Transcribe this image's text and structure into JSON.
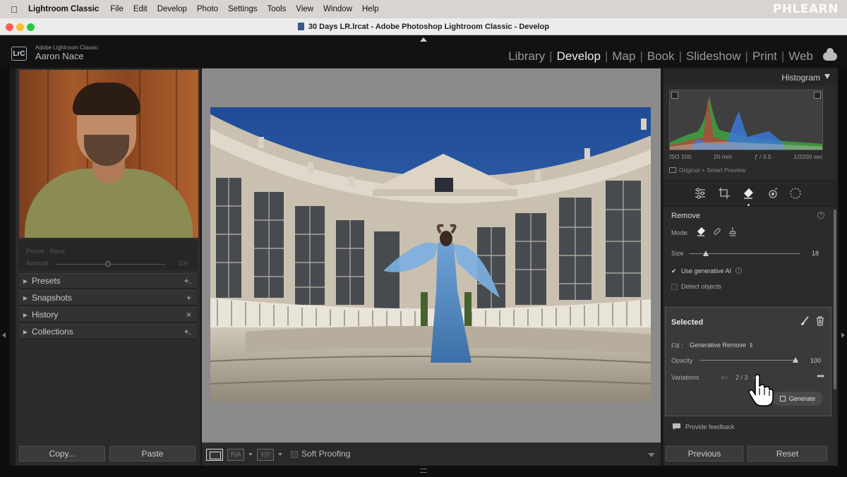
{
  "menubar": {
    "app_name": "Lightroom Classic",
    "items": [
      "File",
      "Edit",
      "Develop",
      "Photo",
      "Settings",
      "Tools",
      "View",
      "Window",
      "Help"
    ],
    "watermark": "PHLEARN"
  },
  "window": {
    "title": "30 Days LR.lrcat - Adobe Photoshop Lightroom Classic - Develop"
  },
  "identity": {
    "badge": "LrC",
    "app_line": "Adobe Lightroom Classic",
    "user_name": "Aaron Nace"
  },
  "modules": {
    "items": [
      "Library",
      "Develop",
      "Map",
      "Book",
      "Slideshow",
      "Print",
      "Web"
    ],
    "active": "Develop"
  },
  "left_panel": {
    "preset": {
      "label": "Preset : None",
      "amount_label": "Amount",
      "amount_value": "100",
      "amount_level": 0.5
    },
    "sections": [
      {
        "label": "Presets",
        "action": "+."
      },
      {
        "label": "Snapshots",
        "action": "+"
      },
      {
        "label": "History",
        "action": "×"
      },
      {
        "label": "Collections",
        "action": "+."
      }
    ],
    "copy_label": "Copy...",
    "paste_label": "Paste"
  },
  "toolbar": {
    "soft_proofing_label": "Soft Proofing"
  },
  "right_panel": {
    "histogram": {
      "title": "Histogram",
      "iso": "ISO 100",
      "focal": "20 mm",
      "aperture": "ƒ / 3.5",
      "shutter": "1/3200 sec",
      "preview": "Original + Smart Preview"
    },
    "remove": {
      "title": "Remove",
      "mode_label": "Mode:",
      "size_label": "Size",
      "size_value": "18",
      "size_level": 0.18,
      "use_genai_label": "Use generative AI",
      "use_genai_checked": true,
      "detect_label": "Detect objects",
      "detect_checked": false
    },
    "selected": {
      "title": "Selected",
      "fill_label": "Fill :",
      "fill_value": "Generative Remove",
      "opacity_label": "Opacity",
      "opacity_value": "100",
      "opacity_level": 1.0,
      "variations_label": "Variations",
      "variations_count": "2 / 3",
      "generate_label": "Generate"
    },
    "feedback_label": "Provide feedback",
    "previous_label": "Previous",
    "reset_label": "Reset"
  }
}
